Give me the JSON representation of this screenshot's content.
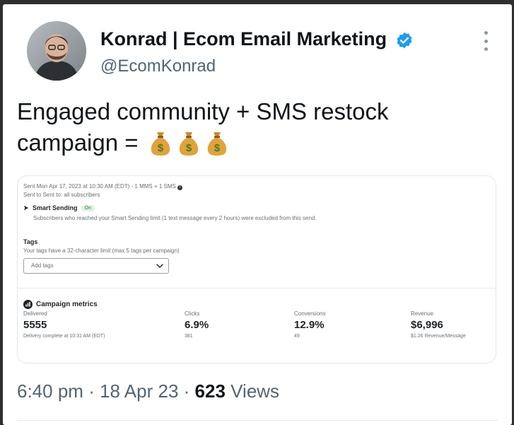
{
  "author": {
    "display_name": "Konrad | Ecom Email Marketing",
    "handle": "@EcomKonrad",
    "avatar_icon": "profile-photo",
    "verified": true,
    "verified_color": "#1d9bf0"
  },
  "tweet": {
    "text": "Engaged community + SMS restock campaign =",
    "emoji": [
      "money-bag",
      "money-bag",
      "money-bag"
    ]
  },
  "embed": {
    "sent_info": "Sent Mon Apr 17, 2023 at 10:30 AM (EDT) - 1 MMS + 1 SMS",
    "sent_to": "Sent to Sent to: all subscribers",
    "smart_sending": {
      "label": "Smart Sending",
      "status": "On",
      "description": "Subscribers who reached your Smart Sending limit (1 text message every 2 hours) were excluded from this send."
    },
    "tags": {
      "label": "Tags",
      "hint": "Your tags have a 32-character limit (max 5 tags per campaign)",
      "placeholder": "Add tags"
    },
    "metrics": {
      "title": "Campaign metrics",
      "items": [
        {
          "label": "Delivered",
          "value": "5555",
          "sub": "Delivery complete at 10:31 AM (EDT)"
        },
        {
          "label": "Clicks",
          "value": "6.9%",
          "sub": "381"
        },
        {
          "label": "Conversions",
          "value": "12.9%",
          "sub": "49"
        },
        {
          "label": "Revenue",
          "value": "$6,996",
          "sub": "$1.26 Revenue/Message"
        }
      ]
    }
  },
  "meta": {
    "time": "6:40 pm",
    "date": "18 Apr 23",
    "views_count": "623",
    "views_label": "Views",
    "separator": "·"
  }
}
